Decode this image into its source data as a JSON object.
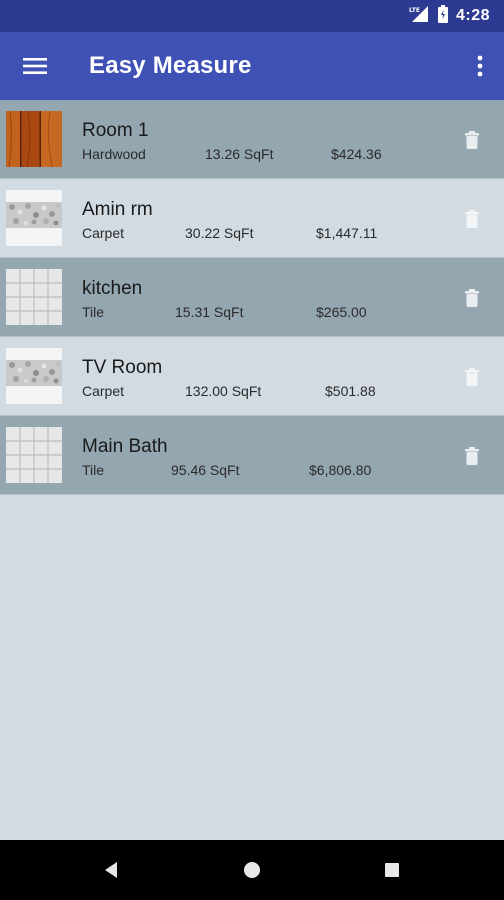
{
  "status_bar": {
    "network": "LTE",
    "time": "4:28"
  },
  "app_bar": {
    "title": "Easy Measure",
    "menu_icon": "hamburger-menu-icon",
    "overflow_icon": "more-vert-icon"
  },
  "rooms": [
    {
      "name": "Room 1",
      "floor": "Hardwood",
      "area": "13.26 SqFt",
      "cost": "$424.36",
      "texture": "hardwood"
    },
    {
      "name": "Amin rm",
      "floor": "Carpet",
      "area": "30.22 SqFt",
      "cost": "$1,447.11",
      "texture": "carpet"
    },
    {
      "name": "kitchen",
      "floor": "Tile",
      "area": "15.31 SqFt",
      "cost": "$265.00",
      "texture": "tile"
    },
    {
      "name": "TV Room",
      "floor": "Carpet",
      "area": "132.00 SqFt",
      "cost": "$501.88",
      "texture": "carpet"
    },
    {
      "name": "Main Bath",
      "floor": "Tile",
      "area": "95.46 SqFt",
      "cost": "$6,806.80",
      "texture": "tile"
    }
  ],
  "colors": {
    "status_bar": "#2d3a91",
    "app_bar": "#3f51b5",
    "row_dark": "#94a6b0",
    "row_light": "#d3dbe2"
  }
}
